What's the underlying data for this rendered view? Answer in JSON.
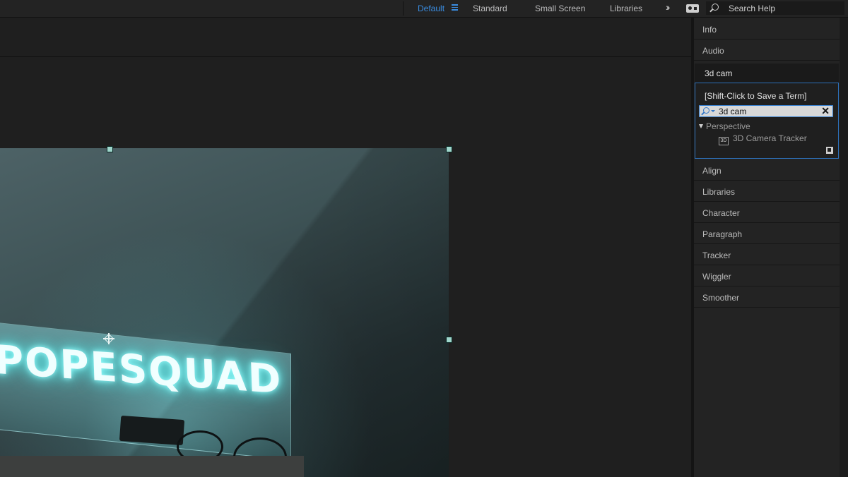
{
  "topbar": {
    "workspaces": [
      {
        "label": "Default",
        "active": true
      },
      {
        "label": "Standard",
        "active": false
      },
      {
        "label": "Small Screen",
        "active": false
      },
      {
        "label": "Libraries",
        "active": false
      }
    ],
    "overflow_icon": "double-chevron-right-icon",
    "search_help_placeholder": "Search Help",
    "accent_color": "#3a8ce0"
  },
  "composition": {
    "neon_text": "POPESQUAD"
  },
  "panels": {
    "above": [
      "Info",
      "Audio"
    ],
    "effects": {
      "header_value": "3d cam",
      "tip": "[Shift-Click to Save a Term]",
      "search_value": "3d cam",
      "category": "Perspective",
      "result": "3D Camera Tracker",
      "result_icon_text": "3D"
    },
    "below": [
      "Align",
      "Libraries",
      "Character",
      "Paragraph",
      "Tracker",
      "Wiggler",
      "Smoother"
    ]
  }
}
